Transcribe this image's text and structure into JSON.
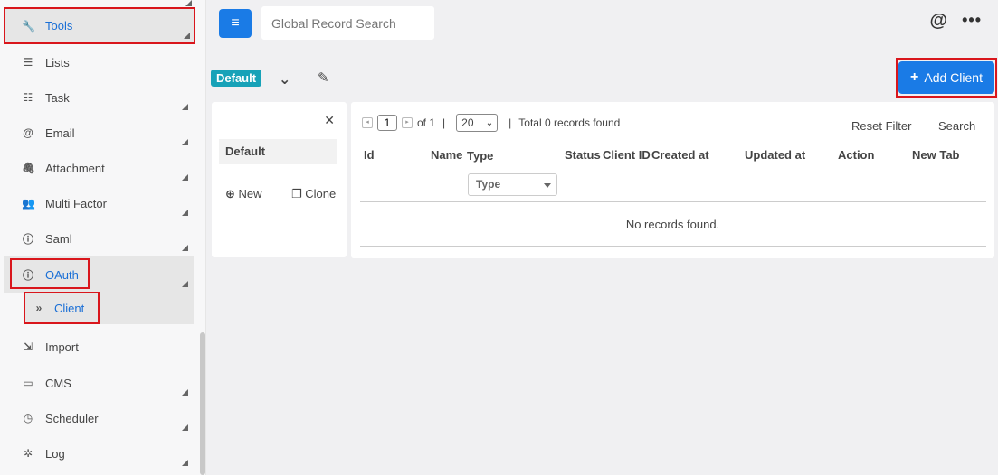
{
  "sidebar": {
    "items": [
      {
        "label": "Tools",
        "icon": "wrench-icon",
        "glyph": "🔧"
      },
      {
        "label": "Lists",
        "icon": "list-icon",
        "glyph": "☰"
      },
      {
        "label": "Task",
        "icon": "checklist-icon",
        "glyph": "☷"
      },
      {
        "label": "Email",
        "icon": "at-icon",
        "glyph": "@"
      },
      {
        "label": "Attachment",
        "icon": "paperclip-icon",
        "glyph": "🖇"
      },
      {
        "label": "Multi Factor",
        "icon": "user-lock-icon",
        "glyph": "👥"
      },
      {
        "label": "Saml",
        "icon": "info-circle-icon",
        "glyph": "ⓘ"
      },
      {
        "label": "OAuth",
        "icon": "info-circle-icon",
        "glyph": "ⓘ"
      },
      {
        "label": "Client",
        "icon": "double-chevron-right-icon",
        "glyph": "»"
      },
      {
        "label": "Import",
        "icon": "import-icon",
        "glyph": "⇲"
      },
      {
        "label": "CMS",
        "icon": "card-icon",
        "glyph": "▭"
      },
      {
        "label": "Scheduler",
        "icon": "clock-icon",
        "glyph": "◷"
      },
      {
        "label": "Log",
        "icon": "bug-icon",
        "glyph": "✲"
      }
    ]
  },
  "topbar": {
    "search_placeholder": "Global Record Search",
    "at_glyph": "@",
    "more_glyph": "•••",
    "menu_glyph": "≡"
  },
  "tabs": {
    "default_label": "Default",
    "chevron_glyph": "⌄",
    "edit_glyph": "✎"
  },
  "add_client": {
    "plus": "+",
    "label": "Add Client"
  },
  "filter_panel": {
    "close_glyph": "✕",
    "default_label": "Default",
    "new_label": "New",
    "new_glyph": "⊕",
    "clone_label": "Clone",
    "clone_glyph": "❐"
  },
  "table": {
    "pager": {
      "prev_glyph": "◂",
      "next_glyph": "▸",
      "page": "1",
      "of_text": "of 1",
      "separator": "|",
      "page_size": "20",
      "total_text": "Total 0 records found"
    },
    "reset_filter": "Reset Filter",
    "search": "Search",
    "columns": [
      "Id",
      "Name",
      "Type",
      "Status",
      "Client ID",
      "Created at",
      "Updated at",
      "Action",
      "New Tab"
    ],
    "type_filter_placeholder": "Type",
    "empty_text": "No records found."
  },
  "colors": {
    "accent": "#1a7be6",
    "badge": "#17a2b8",
    "highlight": "#d9161c"
  }
}
